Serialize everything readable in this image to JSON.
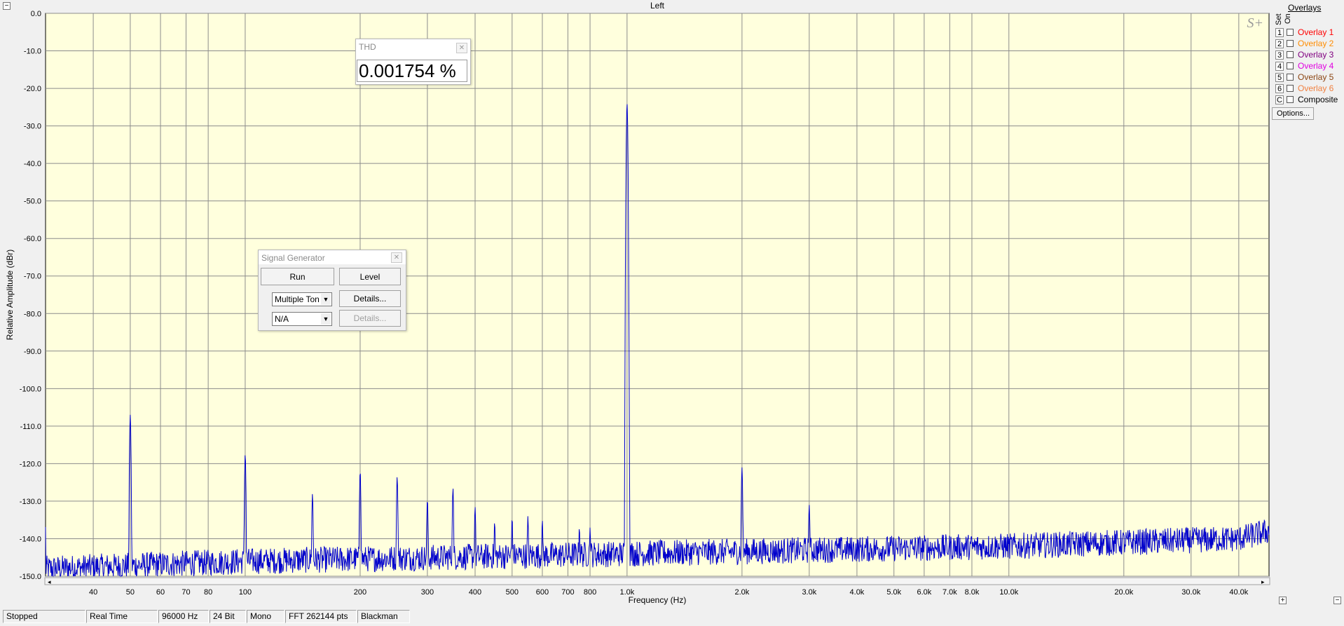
{
  "window": {
    "title": "Left",
    "watermark": "S+"
  },
  "overlays": {
    "header": "Overlays",
    "set_label": "Set",
    "on_label": "On",
    "items": [
      {
        "set": "1",
        "label": "Overlay 1",
        "color": "#ff0000",
        "checked": false
      },
      {
        "set": "2",
        "label": "Overlay 2",
        "color": "#ff8c00",
        "checked": false
      },
      {
        "set": "3",
        "label": "Overlay 3",
        "color": "#800080",
        "checked": false
      },
      {
        "set": "4",
        "label": "Overlay 4",
        "color": "#e000e0",
        "checked": false
      },
      {
        "set": "5",
        "label": "Overlay 5",
        "color": "#8b4513",
        "checked": false
      },
      {
        "set": "6",
        "label": "Overlay 6",
        "color": "#f08040",
        "checked": false
      },
      {
        "set": "C",
        "label": "Composite",
        "color": "#000000",
        "checked": false
      }
    ],
    "options_label": "Options..."
  },
  "thd": {
    "title": "THD",
    "value": "0.001754 %"
  },
  "signal_generator": {
    "title": "Signal Generator",
    "run_label": "Run",
    "level_label": "Level",
    "waveform_selected": "Multiple Ton",
    "details1_label": "Details...",
    "secondary_selected": "N/A",
    "details2_label": "Details..."
  },
  "status": {
    "state": "Stopped",
    "mode": "Real Time",
    "sample_rate": "96000 Hz",
    "bit_depth": "24 Bit",
    "channels": "Mono",
    "fft": "FFT 262144 pts",
    "window_fn": "Blackman"
  },
  "chart_data": {
    "type": "line",
    "title": "Left",
    "xlabel": "Frequency (Hz)",
    "ylabel": "Relative Amplitude (dBr)",
    "x_scale": "log",
    "xlim": [
      30,
      48000
    ],
    "ylim": [
      -150,
      0
    ],
    "grid": true,
    "background": "#ffffdd",
    "line_color": "#0000cc",
    "x_ticks": [
      {
        "v": 40,
        "label": "40"
      },
      {
        "v": 50,
        "label": "50"
      },
      {
        "v": 60,
        "label": "60"
      },
      {
        "v": 70,
        "label": "70"
      },
      {
        "v": 80,
        "label": "80"
      },
      {
        "v": 100,
        "label": "100"
      },
      {
        "v": 200,
        "label": "200"
      },
      {
        "v": 300,
        "label": "300"
      },
      {
        "v": 400,
        "label": "400"
      },
      {
        "v": 500,
        "label": "500"
      },
      {
        "v": 600,
        "label": "600"
      },
      {
        "v": 700,
        "label": "700"
      },
      {
        "v": 800,
        "label": "800"
      },
      {
        "v": 1000,
        "label": "1.0k"
      },
      {
        "v": 2000,
        "label": "2.0k"
      },
      {
        "v": 3000,
        "label": "3.0k"
      },
      {
        "v": 4000,
        "label": "4.0k"
      },
      {
        "v": 5000,
        "label": "5.0k"
      },
      {
        "v": 6000,
        "label": "6.0k"
      },
      {
        "v": 7000,
        "label": "7.0k"
      },
      {
        "v": 8000,
        "label": "8.0k"
      },
      {
        "v": 10000,
        "label": "10.0k"
      },
      {
        "v": 20000,
        "label": "20.0k"
      },
      {
        "v": 30000,
        "label": "30.0k"
      },
      {
        "v": 40000,
        "label": "40.0k"
      }
    ],
    "y_ticks": [
      {
        "v": 0,
        "label": "0.0"
      },
      {
        "v": -10,
        "label": "-10.0"
      },
      {
        "v": -20,
        "label": "-20.0"
      },
      {
        "v": -30,
        "label": "-30.0"
      },
      {
        "v": -40,
        "label": "-40.0"
      },
      {
        "v": -50,
        "label": "-50.0"
      },
      {
        "v": -60,
        "label": "-60.0"
      },
      {
        "v": -70,
        "label": "-70.0"
      },
      {
        "v": -80,
        "label": "-80.0"
      },
      {
        "v": -90,
        "label": "-90.0"
      },
      {
        "v": -100,
        "label": "-100.0"
      },
      {
        "v": -110,
        "label": "-110.0"
      },
      {
        "v": -120,
        "label": "-120.0"
      },
      {
        "v": -130,
        "label": "-130.0"
      },
      {
        "v": -140,
        "label": "-140.0"
      },
      {
        "v": -150,
        "label": "-150.0"
      }
    ],
    "noise_floor_db": [
      {
        "f": 30,
        "db": -148
      },
      {
        "f": 100,
        "db": -146
      },
      {
        "f": 1000,
        "db": -144
      },
      {
        "f": 10000,
        "db": -142
      },
      {
        "f": 40000,
        "db": -140
      },
      {
        "f": 48000,
        "db": -138
      }
    ],
    "peaks": [
      {
        "f": 50,
        "db": -107
      },
      {
        "f": 100,
        "db": -117.5
      },
      {
        "f": 150,
        "db": -128
      },
      {
        "f": 200,
        "db": -122
      },
      {
        "f": 250,
        "db": -123.5
      },
      {
        "f": 300,
        "db": -129.5
      },
      {
        "f": 350,
        "db": -126.5
      },
      {
        "f": 400,
        "db": -131.5
      },
      {
        "f": 450,
        "db": -135.5
      },
      {
        "f": 500,
        "db": -134.5
      },
      {
        "f": 550,
        "db": -134
      },
      {
        "f": 600,
        "db": -135
      },
      {
        "f": 750,
        "db": -137
      },
      {
        "f": 800,
        "db": -137
      },
      {
        "f": 1000,
        "db": -24
      },
      {
        "f": 2000,
        "db": -121
      },
      {
        "f": 3000,
        "db": -131
      }
    ]
  }
}
